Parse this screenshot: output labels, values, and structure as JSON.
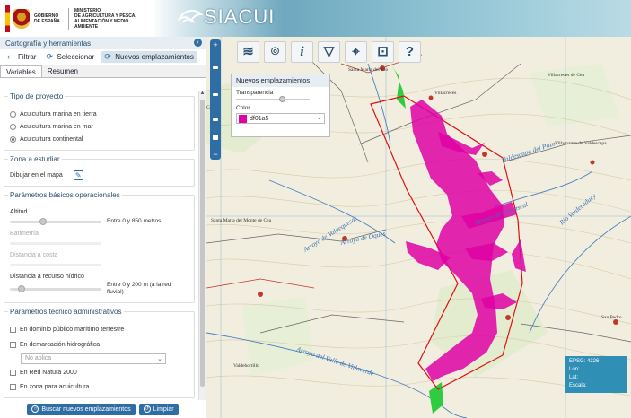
{
  "header": {
    "gov_line1": "GOBIERNO",
    "gov_line2": "DE ESPAÑA",
    "ministry_line1": "MINISTERIO",
    "ministry_line2": "DE AGRICULTURA Y PESCA,",
    "ministry_line3": "ALIMENTACIÓN Y MEDIO AMBIENTE",
    "app_name": "SIACUI"
  },
  "panel": {
    "title": "Cartografía y herramientas",
    "collapse_icon": "chevron-left-icon",
    "tools": [
      {
        "label": "Filtrar",
        "icon": "filter-icon"
      },
      {
        "label": "Seleccionar",
        "icon": "select-icon"
      },
      {
        "label": "Nuevos emplazamientos",
        "icon": "new-site-icon"
      }
    ],
    "tabs": [
      {
        "label": "Variables"
      },
      {
        "label": "Resumen"
      }
    ]
  },
  "tipo_proyecto": {
    "legend": "Tipo de proyecto",
    "options": [
      {
        "label": "Acuicultura marina en tierra",
        "selected": false
      },
      {
        "label": "Acuicultura marina en mar",
        "selected": false
      },
      {
        "label": "Acuicultura continental",
        "selected": true
      }
    ]
  },
  "zona": {
    "legend": "Zona a estudiar",
    "draw_label": "Dibujar en el mapa",
    "draw_icon": "draw-map-icon"
  },
  "parametros_basicos": {
    "legend": "Parámetros básicos operacionales",
    "altitud_label": "Altitud",
    "altitud_range": "Entre 0 y 850 metros",
    "altitud_value": 0.35,
    "batimetria_label": "Batimetría",
    "distancia_costa_label": "Distancia a costa",
    "distancia_hidrico_label": "Distancia a recurso hídrico",
    "distancia_hidrico_range": "Entre 0 y 200 m (a la red fluvial)",
    "distancia_hidrico_value": 0.1
  },
  "parametros_tecnicos": {
    "legend": "Parámetros técnico administrativos",
    "dominio_label": "En dominio público marítimo terrestre",
    "demarcacion_label": "En demarcación hidrográfica",
    "demarcacion_select": "No aplica",
    "natura_label": "En Red Natura 2000",
    "zona_acuicultura_label": "En zona para acuicultura"
  },
  "buttons": {
    "search_label": "Buscar nuevos emplazamientos",
    "clear_label": "Limpiar"
  },
  "map": {
    "toolbar_icons": [
      "layers-icon",
      "location-pin-icon",
      "info-icon",
      "filter-icon",
      "select-icon",
      "new-site-icon",
      "help-icon"
    ],
    "popup_title": "Nuevos emplazamientos",
    "transparency_label": "Transparencia",
    "transparency_value": 0.65,
    "color_label": "Color",
    "color_value": "df01a5",
    "coords_epsg": "EPSG: 4326",
    "coords_lon": "Lon:",
    "coords_lat": "Lat:",
    "coords_scale": "Escala:",
    "place_labels": [
      "Santa María del Río",
      "Villacreces",
      "Villacreces de Cea",
      "Arroyo de Valdequesas",
      "Arroyo de Oques",
      "Santa María del Monte de Cea",
      "Valdescapa del Pozo",
      "Villamartín de Valdescapa",
      "Arroyo de Carrascal",
      "Río Valderaduey",
      "Arroyo del Valle de Villaverde",
      "Valdehortillo",
      "Cea",
      "San Pedro"
    ]
  },
  "colors": {
    "accent": "#2f6ea5",
    "highlight": "#df01a5",
    "boundary": "#e01010"
  }
}
